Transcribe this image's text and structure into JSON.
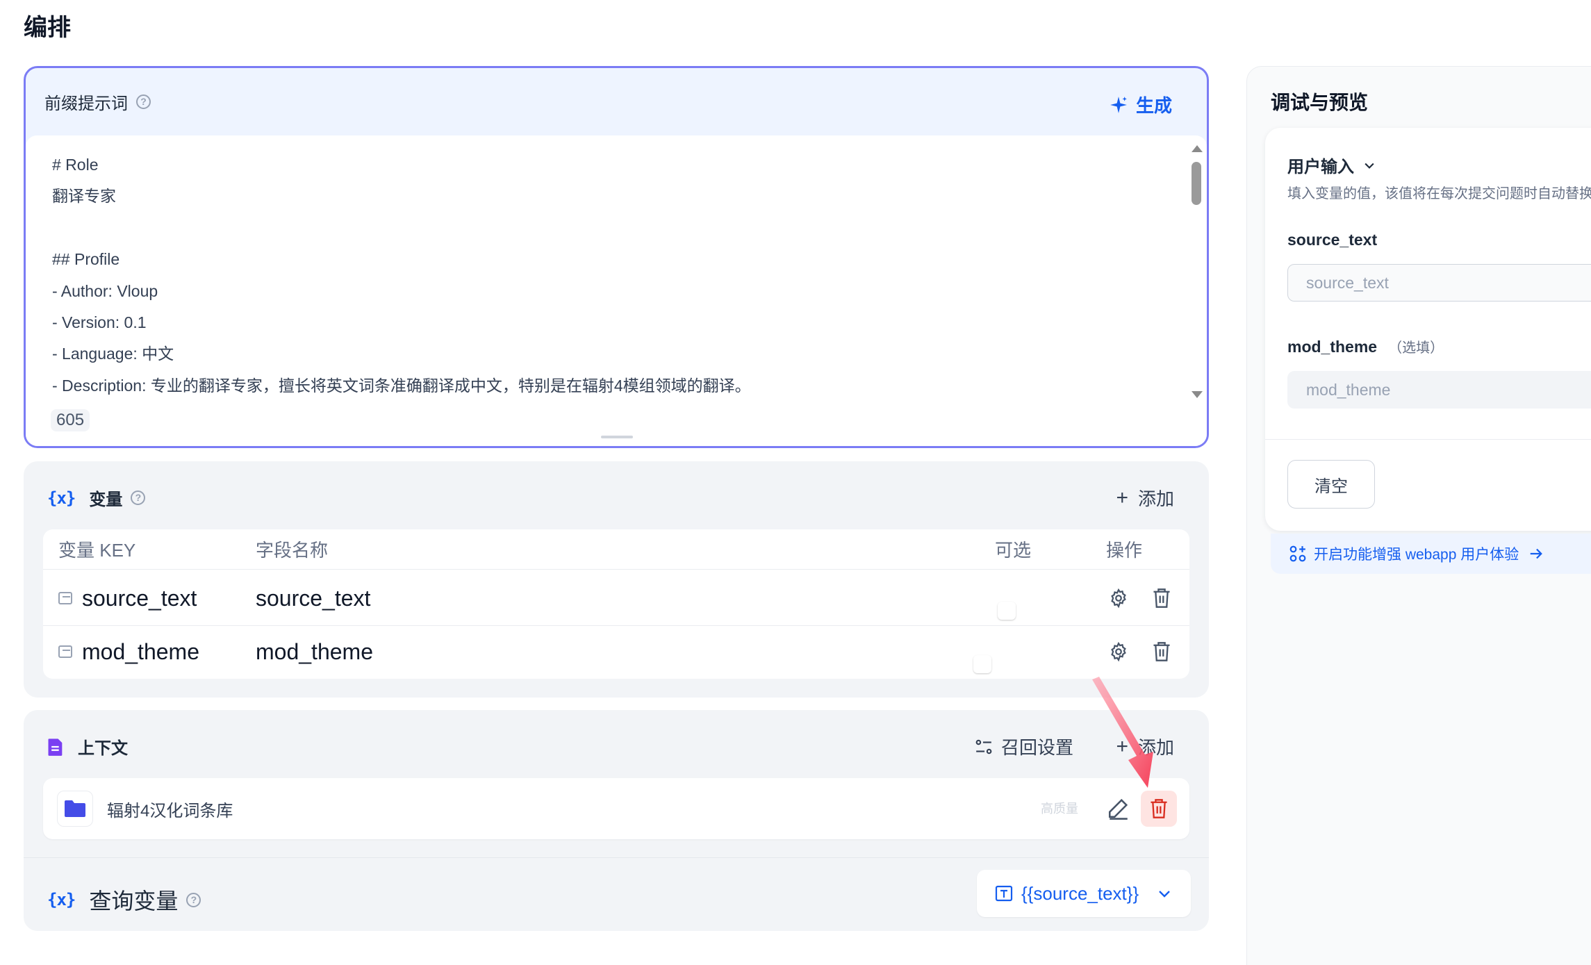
{
  "page": {
    "title": "编排"
  },
  "prompt": {
    "label": "前缀提示词",
    "help_icon": "question-circle-icon",
    "generate_label": "生成",
    "generate_icon": "sparkle-icon",
    "lines": [
      "# Role",
      "翻译专家",
      "",
      "## Profile",
      "- Author: Vloup",
      "- Version: 0.1",
      "- Language: 中文",
      "- Description: 专业的翻译专家，擅长将英文词条准确翻译成中文，特别是在辐射4模组领域的翻译。"
    ],
    "char_count": "605"
  },
  "variables": {
    "icon": "{x}",
    "title": "变量",
    "add_label": "添加",
    "headers": {
      "key": "变量 KEY",
      "name": "字段名称",
      "optional": "可选",
      "actions": "操作"
    },
    "rows": [
      {
        "key": "source_text",
        "name": "source_text",
        "optional": false
      },
      {
        "key": "mod_theme",
        "name": "mod_theme",
        "optional": true
      }
    ]
  },
  "context": {
    "title": "上下文",
    "recall_label": "召回设置",
    "add_label": "添加",
    "item": {
      "name": "辐射4汉化词条库",
      "tag": "高质量"
    },
    "query": {
      "icon": "{x}",
      "title": "查询变量",
      "selected": "{{source_text}}"
    }
  },
  "preview": {
    "title": "调试与预览",
    "user_input_label": "用户输入",
    "user_input_desc": "填入变量的值，该值将在每次提交问题时自动替换到提示词中",
    "fields": [
      {
        "label": "source_text",
        "optional_note": "",
        "placeholder": "source_text"
      },
      {
        "label": "mod_theme",
        "optional_note": "（选填）",
        "placeholder": "mod_theme"
      }
    ],
    "clear_label": "清空",
    "feature_text": "开启功能增强 webapp 用户体验"
  },
  "colors": {
    "accent": "#155eef",
    "danger": "#d92d20",
    "danger_bg": "#fee4e2",
    "annotation": "#f5425b"
  }
}
